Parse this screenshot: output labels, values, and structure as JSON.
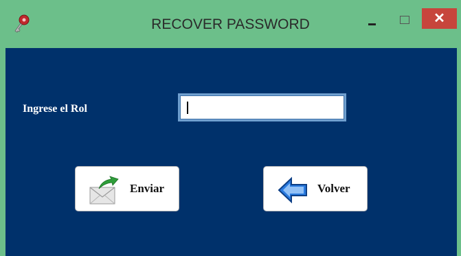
{
  "window": {
    "title": "RECOVER PASSWORD",
    "icon": "key-icon",
    "controls": {
      "minimize": "minimize-icon",
      "maximize": "maximize-icon",
      "close": "✕"
    }
  },
  "form": {
    "role_label": "Ingrese el Rol",
    "role_value": "",
    "role_placeholder": ""
  },
  "buttons": {
    "send_label": "Enviar",
    "send_icon": "mail-send-icon",
    "back_label": "Volver",
    "back_icon": "back-arrow-icon"
  },
  "colors": {
    "titlebar": "#6cbf8a",
    "client_background": "#00316b",
    "close_button": "#c7453c"
  }
}
